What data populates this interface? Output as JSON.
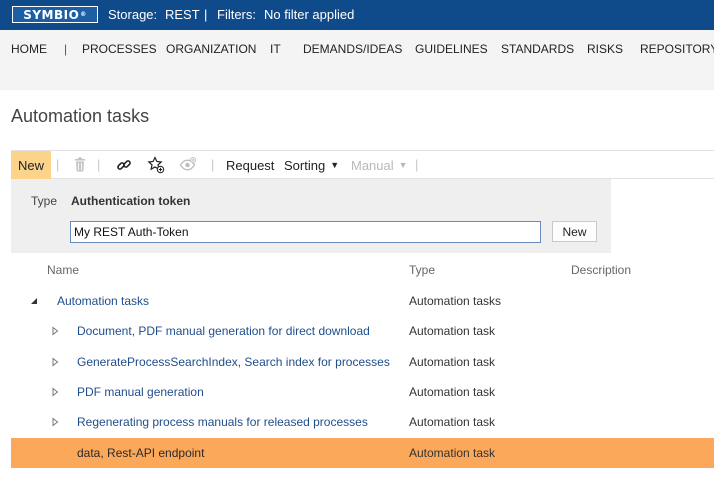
{
  "topbar": {
    "logo": "SYMBIO",
    "storage_label": "Storage:",
    "storage_value": "REST",
    "separator": "|",
    "filters_label": "Filters:",
    "filters_value": "No filter applied",
    "bg_color": "#0f4a8a"
  },
  "nav": {
    "items": [
      "HOME",
      "PROCESSES",
      "ORGANIZATION",
      "IT",
      "DEMANDS/IDEAS",
      "GUIDELINES",
      "STANDARDS",
      "RISKS",
      "REPOSITORY"
    ],
    "separator": "|"
  },
  "page": {
    "title": "Automation tasks"
  },
  "toolbar": {
    "new_label": "New",
    "request_label": "Request",
    "sorting_label": "Sorting",
    "manual_label": "Manual",
    "separator": "|",
    "icons": [
      "trash-icon",
      "link-icon",
      "star-add-icon",
      "eye-add-icon"
    ],
    "accent": "#fbd38a"
  },
  "form": {
    "type_label": "Type",
    "type_value": "Authentication token",
    "input_value": "My REST Auth-Token",
    "new_button": "New"
  },
  "table": {
    "columns": [
      "Name",
      "Type",
      "Description"
    ],
    "root": {
      "name": "Automation tasks",
      "type": "Automation tasks",
      "expanded": true
    },
    "rows": [
      {
        "name": "Document, PDF manual generation for direct download",
        "type": "Automation task",
        "has_children": true
      },
      {
        "name": "GenerateProcessSearchIndex, Search index for processes",
        "type": "Automation task",
        "has_children": true
      },
      {
        "name": "PDF manual generation",
        "type": "Automation task",
        "has_children": true
      },
      {
        "name": "Regenerating process manuals for released processes",
        "type": "Automation task",
        "has_children": true
      },
      {
        "name": "data, Rest-API endpoint",
        "type": "Automation task",
        "has_children": false,
        "selected": true
      }
    ],
    "selected_color": "#fba85a"
  }
}
